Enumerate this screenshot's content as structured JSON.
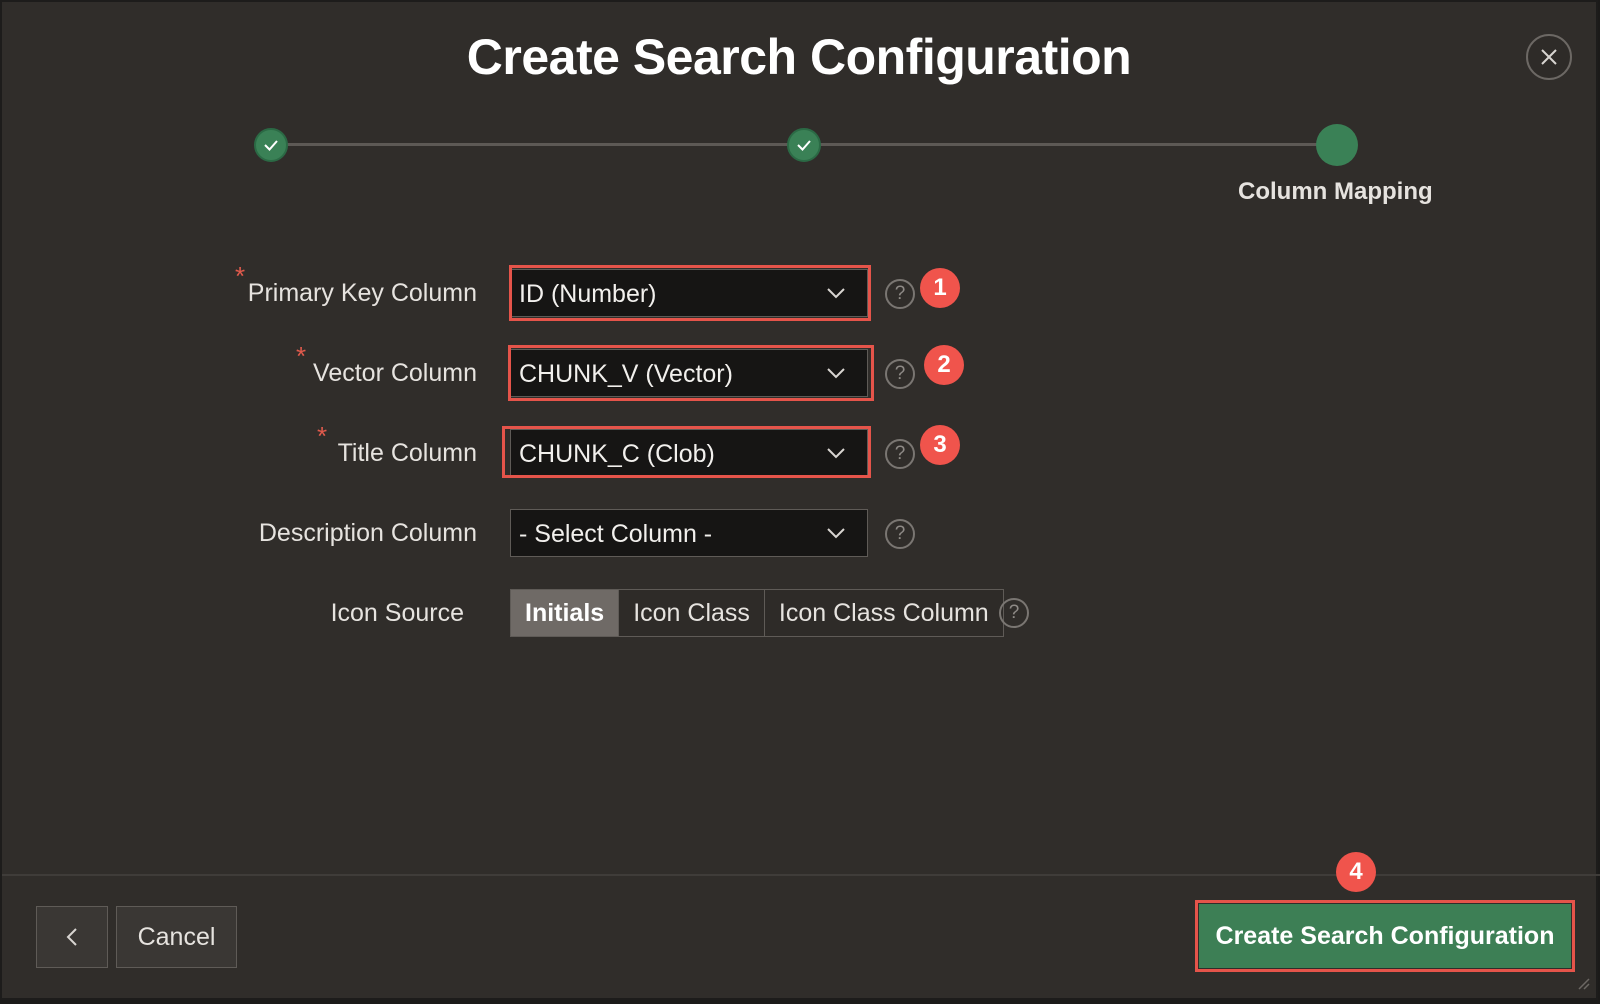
{
  "dialog": {
    "title": "Create Search Configuration",
    "close_icon": "close-icon"
  },
  "wizard": {
    "steps": [
      {
        "status": "complete",
        "icon": "check-icon"
      },
      {
        "status": "complete",
        "icon": "check-icon"
      },
      {
        "status": "current",
        "label": "Column Mapping"
      }
    ]
  },
  "form": {
    "primary_key": {
      "label": "Primary Key Column",
      "required": "*",
      "value": "ID (Number)",
      "badge": "1"
    },
    "vector": {
      "label": "Vector Column",
      "required": "*",
      "value": "CHUNK_V (Vector)",
      "badge": "2"
    },
    "title": {
      "label": "Title Column",
      "required": "*",
      "value": "CHUNK_C (Clob)",
      "badge": "3"
    },
    "description": {
      "label": "Description Column",
      "value": "- Select Column -"
    },
    "icon_source": {
      "label": "Icon Source",
      "options": [
        "Initials",
        "Icon Class",
        "Icon Class Column"
      ],
      "selected": "Initials"
    },
    "help_glyph": "?"
  },
  "footer": {
    "cancel_label": "Cancel",
    "create_label": "Create Search Configuration",
    "create_badge": "4"
  },
  "colors": {
    "accent_green": "#3d7f55",
    "highlight_red": "#e5544a",
    "badge_red": "#f0544c",
    "background": "#302d2a"
  }
}
